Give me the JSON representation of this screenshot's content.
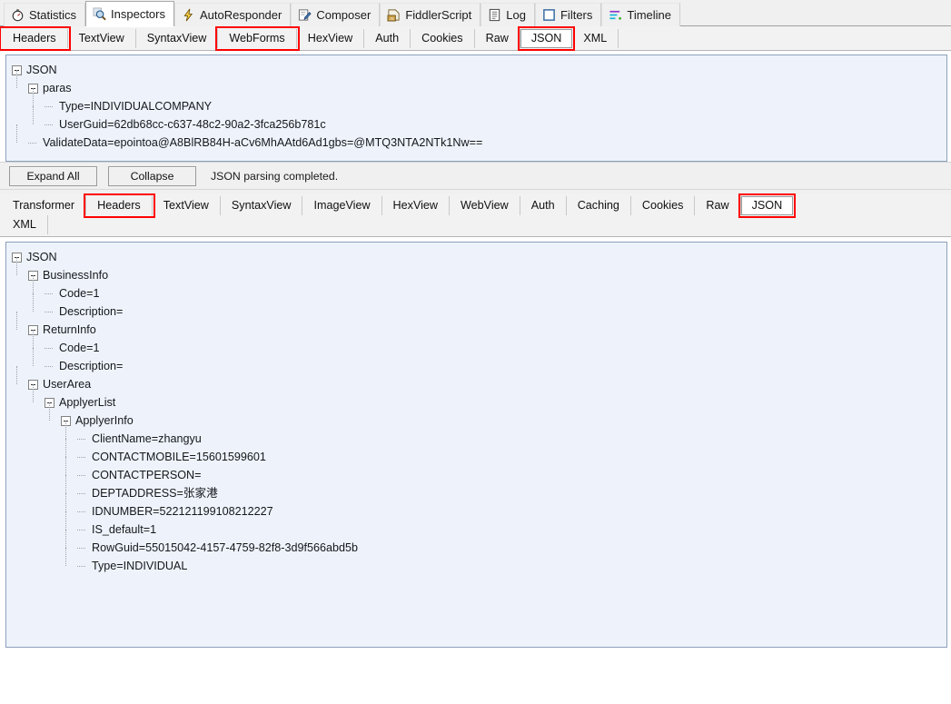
{
  "primary_tabs": [
    {
      "label": "Statistics",
      "icon": "stopwatch-icon",
      "active": false
    },
    {
      "label": "Inspectors",
      "icon": "magnifier-icon",
      "active": true
    },
    {
      "label": "AutoResponder",
      "icon": "lightning-icon",
      "active": false
    },
    {
      "label": "Composer",
      "icon": "compose-pencil-icon",
      "active": false
    },
    {
      "label": "FiddlerScript",
      "icon": "js-script-icon",
      "active": false
    },
    {
      "label": "Log",
      "icon": "log-document-icon",
      "active": false
    },
    {
      "label": "Filters",
      "icon": "filter-square-icon",
      "active": false
    },
    {
      "label": "Timeline",
      "icon": "timeline-bars-icon",
      "active": false
    }
  ],
  "request_inspector": {
    "tabs": [
      {
        "label": "Headers",
        "selected": false,
        "highlighted": true
      },
      {
        "label": "TextView",
        "selected": false,
        "highlighted": false
      },
      {
        "label": "SyntaxView",
        "selected": false,
        "highlighted": false
      },
      {
        "label": "WebForms",
        "selected": false,
        "highlighted": true
      },
      {
        "label": "HexView",
        "selected": false,
        "highlighted": false
      },
      {
        "label": "Auth",
        "selected": false,
        "highlighted": false
      },
      {
        "label": "Cookies",
        "selected": false,
        "highlighted": false
      },
      {
        "label": "Raw",
        "selected": false,
        "highlighted": false
      },
      {
        "label": "JSON",
        "selected": true,
        "highlighted": true
      },
      {
        "label": "XML",
        "selected": false,
        "highlighted": false
      }
    ],
    "tree": [
      {
        "depth": 0,
        "expander": true,
        "text": "JSON"
      },
      {
        "depth": 1,
        "expander": true,
        "text": "paras"
      },
      {
        "depth": 2,
        "expander": false,
        "text": "Type=INDIVIDUALCOMPANY"
      },
      {
        "depth": 2,
        "expander": false,
        "text": "UserGuid=62db68cc-c637-48c2-90a2-3fca256b781c"
      },
      {
        "depth": 1,
        "expander": false,
        "text": "ValidateData=epointoa@A8BlRB84H-aCv6MhAAtd6Ad1gbs=@MTQ3NTA2NTk1Nw=="
      }
    ],
    "expand_all_label": "Expand All",
    "collapse_label": "Collapse",
    "status_text": "JSON parsing completed."
  },
  "response_inspector": {
    "tabs": [
      {
        "label": "Transformer",
        "selected": false,
        "highlighted": false
      },
      {
        "label": "Headers",
        "selected": false,
        "highlighted": true
      },
      {
        "label": "TextView",
        "selected": false,
        "highlighted": false
      },
      {
        "label": "SyntaxView",
        "selected": false,
        "highlighted": false
      },
      {
        "label": "ImageView",
        "selected": false,
        "highlighted": false
      },
      {
        "label": "HexView",
        "selected": false,
        "highlighted": false
      },
      {
        "label": "WebView",
        "selected": false,
        "highlighted": false
      },
      {
        "label": "Auth",
        "selected": false,
        "highlighted": false
      },
      {
        "label": "Caching",
        "selected": false,
        "highlighted": false
      },
      {
        "label": "Cookies",
        "selected": false,
        "highlighted": false
      },
      {
        "label": "Raw",
        "selected": false,
        "highlighted": false
      },
      {
        "label": "JSON",
        "selected": true,
        "highlighted": true
      },
      {
        "label": "XML",
        "selected": false,
        "highlighted": false
      }
    ],
    "tree": [
      {
        "depth": 0,
        "expander": true,
        "text": "JSON"
      },
      {
        "depth": 1,
        "expander": true,
        "text": "BusinessInfo"
      },
      {
        "depth": 2,
        "expander": false,
        "text": "Code=1"
      },
      {
        "depth": 2,
        "expander": false,
        "text": "Description="
      },
      {
        "depth": 1,
        "expander": true,
        "text": "ReturnInfo"
      },
      {
        "depth": 2,
        "expander": false,
        "text": "Code=1"
      },
      {
        "depth": 2,
        "expander": false,
        "text": "Description="
      },
      {
        "depth": 1,
        "expander": true,
        "text": "UserArea"
      },
      {
        "depth": 2,
        "expander": true,
        "text": "ApplyerList"
      },
      {
        "depth": 3,
        "expander": true,
        "text": "ApplyerInfo"
      },
      {
        "depth": 4,
        "expander": false,
        "text": "ClientName=zhangyu"
      },
      {
        "depth": 4,
        "expander": false,
        "text": "CONTACTMOBILE=15601599601"
      },
      {
        "depth": 4,
        "expander": false,
        "text": "CONTACTPERSON="
      },
      {
        "depth": 4,
        "expander": false,
        "text": "DEPTADDRESS=张家港"
      },
      {
        "depth": 4,
        "expander": false,
        "text": "IDNUMBER=522121199108212227"
      },
      {
        "depth": 4,
        "expander": false,
        "text": "IS_default=1"
      },
      {
        "depth": 4,
        "expander": false,
        "text": "RowGuid=55015042-4157-4759-82f8-3d9f566abd5b"
      },
      {
        "depth": 4,
        "expander": false,
        "text": "Type=INDIVIDUAL"
      }
    ]
  },
  "colors": {
    "highlight": "#ff0000",
    "tree_background": "#eef3fb",
    "chrome": "#f0f0f0",
    "selected_tab": "#ffffff"
  }
}
